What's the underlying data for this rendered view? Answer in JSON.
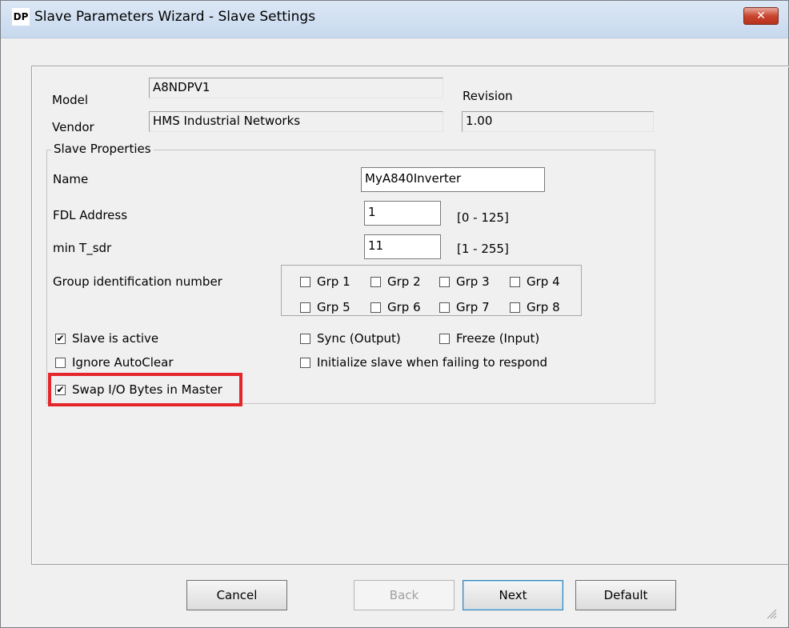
{
  "window": {
    "app_icon_text": "DP",
    "title": "Slave Parameters Wizard - Slave Settings",
    "close_glyph": "✕"
  },
  "info": {
    "model_label": "Model",
    "model_value": "A8NDPV1",
    "vendor_label": "Vendor",
    "vendor_value": "HMS Industrial Networks",
    "revision_label": "Revision",
    "revision_value": "1.00"
  },
  "slave_properties": {
    "legend": "Slave Properties",
    "name_label": "Name",
    "name_value": "MyA840Inverter",
    "fdl_label": "FDL Address",
    "fdl_value": "1",
    "fdl_range": "[0 - 125]",
    "tsdr_label": "min T_sdr",
    "tsdr_value": "11",
    "tsdr_range": "[1 - 255]",
    "group_label": "Group identification number",
    "groups": [
      {
        "label": "Grp 1",
        "checked": false
      },
      {
        "label": "Grp 2",
        "checked": false
      },
      {
        "label": "Grp 3",
        "checked": false
      },
      {
        "label": "Grp 4",
        "checked": false
      },
      {
        "label": "Grp 5",
        "checked": false
      },
      {
        "label": "Grp 6",
        "checked": false
      },
      {
        "label": "Grp 7",
        "checked": false
      },
      {
        "label": "Grp 8",
        "checked": false
      }
    ],
    "options": {
      "slave_active": {
        "label": "Slave is active",
        "checked": true
      },
      "ignore_autoclear": {
        "label": "Ignore AutoClear",
        "checked": false
      },
      "swap_io": {
        "label": "Swap I/O Bytes in Master",
        "checked": true
      },
      "sync_output": {
        "label": "Sync (Output)",
        "checked": false
      },
      "freeze_input": {
        "label": "Freeze (Input)",
        "checked": false
      },
      "init_slave": {
        "label": "Initialize slave when failing to respond",
        "checked": false
      }
    },
    "check_glyph": "✔"
  },
  "buttons": {
    "cancel": "Cancel",
    "back": "Back",
    "next": "Next",
    "default": "Default"
  },
  "colors": {
    "highlight": "#e4262b",
    "close": "#c9452f"
  }
}
